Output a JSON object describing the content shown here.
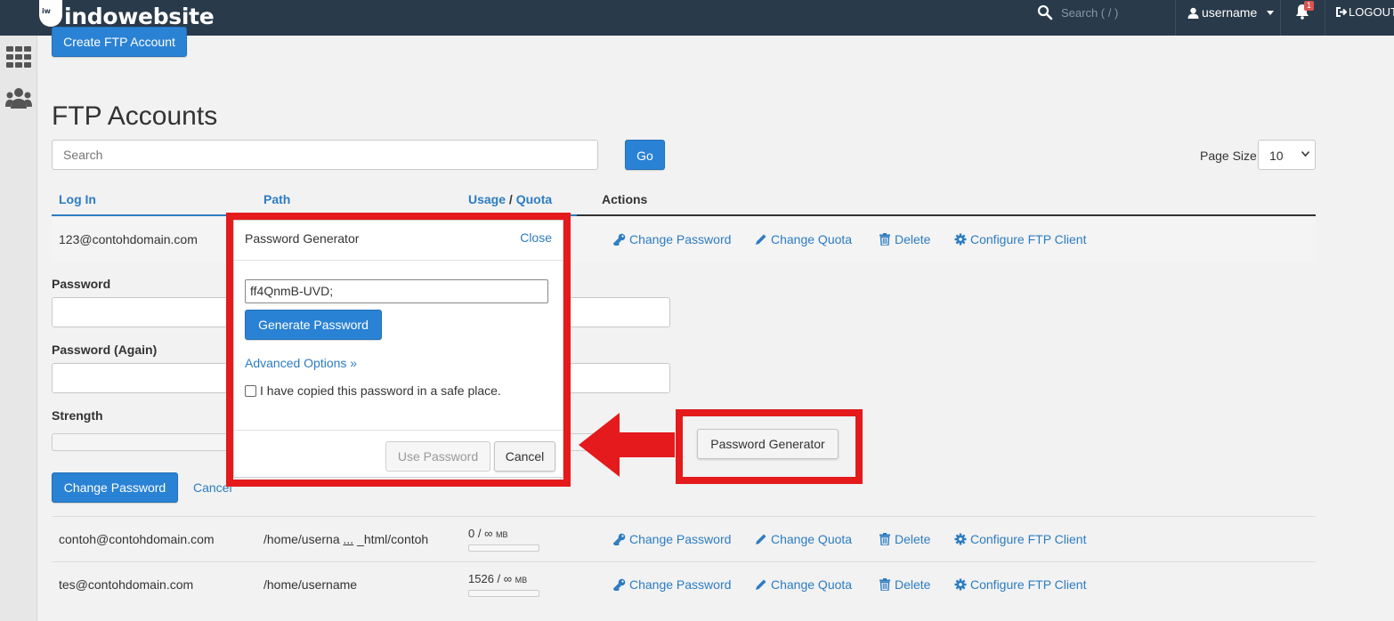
{
  "brand": {
    "name": "indowebsite"
  },
  "topbar": {
    "search_placeholder": "Search ( / )",
    "user": "username",
    "notification_count": "1",
    "logout": "LOGOUT"
  },
  "page": {
    "create_button": "Create FTP Account",
    "title": "FTP Accounts",
    "search_placeholder": "Search",
    "go_button": "Go",
    "page_size_label": "Page Size",
    "page_size_value": "10"
  },
  "table": {
    "headers": {
      "login": "Log In",
      "path": "Path",
      "usage": "Usage",
      "slash": "/",
      "quota": "Quota",
      "actions": "Actions"
    },
    "actions": {
      "change_password": "Change Password",
      "change_quota": "Change Quota",
      "delete": "Delete",
      "configure": "Configure FTP Client"
    },
    "rows": [
      {
        "login": "123@contohdomain.com"
      },
      {
        "login": "contoh@contohdomain.com",
        "path_start": "/home/userna",
        "path_ellipsis": "...",
        "path_end": "_html/contoh",
        "usage": "0 / ∞",
        "unit": "MB"
      },
      {
        "login": "tes@contohdomain.com",
        "path": "/home/username",
        "usage": "1526 / ∞",
        "unit": "MB"
      }
    ]
  },
  "form": {
    "password_label": "Password",
    "password_again_label": "Password (Again)",
    "strength_label": "Strength",
    "change_password_button": "Change Password",
    "cancel_link": "Cancel",
    "password_generator_button": "Password Generator"
  },
  "modal": {
    "title": "Password Generator",
    "close": "Close",
    "generated_password": "ff4QnmB-UVD;",
    "generate_button": "Generate Password",
    "advanced_options": "Advanced Options »",
    "copied_checkbox": "I have copied this password in a safe place.",
    "use_password_button": "Use Password",
    "cancel_button": "Cancel"
  },
  "annotation_color": "#e41a1c"
}
